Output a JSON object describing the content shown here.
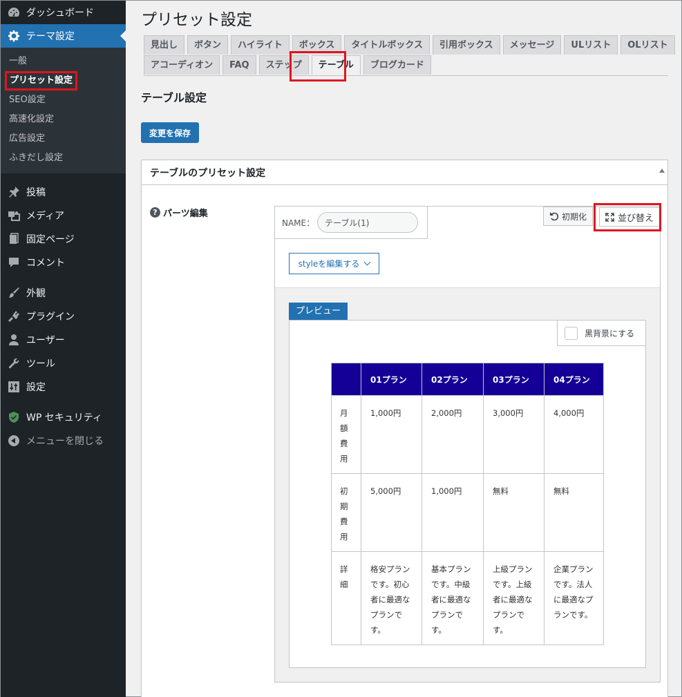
{
  "sidebar": {
    "dashboard": "ダッシュボード",
    "theme_settings": "テーマ設定",
    "submenu": [
      "一般",
      "プリセット設定",
      "SEO設定",
      "高速化設定",
      "広告設定",
      "ふきだし設定"
    ],
    "posts": "投稿",
    "media": "メディア",
    "pages": "固定ページ",
    "comments": "コメント",
    "appearance": "外観",
    "plugins": "プラグイン",
    "users": "ユーザー",
    "tools": "ツール",
    "settings": "設定",
    "wp_security": "WP セキュリティ",
    "collapse": "メニューを閉じる"
  },
  "page": {
    "title": "プリセット設定",
    "tabs_row1": [
      "見出し",
      "ボタン",
      "ハイライト",
      "ボックス",
      "タイトルボックス",
      "引用ボックス",
      "メッセージ",
      "ULリスト",
      "OLリスト"
    ],
    "tabs_row2": [
      "アコーディオン",
      "FAQ",
      "ステップ",
      "テーブル",
      "ブログカード"
    ],
    "active_tab": "テーブル",
    "section_title": "テーブル設定",
    "save_button": "変更を保存"
  },
  "postbox": {
    "title": "テーブルのプリセット設定",
    "parts_label": "パーツ編集",
    "help_icon": "?",
    "name_label": "NAME：",
    "name_value": "テーブル(1)",
    "reset_button": "初期化",
    "sort_button": "並び替え",
    "style_button": "styleを編集する",
    "preview_tab": "プレビュー",
    "dark_bg_label": "黒背景にする"
  },
  "table": {
    "headers": [
      "",
      "01プラン",
      "02プラン",
      "03プラン",
      "04プラン"
    ],
    "rows": [
      {
        "label": "月額費用",
        "cells": [
          "1,000円",
          "2,000円",
          "3,000円",
          "4,000円"
        ]
      },
      {
        "label": "初期費用",
        "cells": [
          "5,000円",
          "1,000円",
          "無料",
          "無料"
        ]
      },
      {
        "label": "詳細",
        "cells": [
          "格安プランです。初心者に最適なプランです。",
          "基本プランです。中級者に最適なプランです。",
          "上級プランです。上級者に最適なプランです。",
          "企業プランです。法人に最適なプランです。"
        ]
      }
    ],
    "header_color": "#140096"
  },
  "colors": {
    "accent": "#2271b1",
    "sidebar": "#1d2327",
    "highlight": "#e0141e"
  }
}
